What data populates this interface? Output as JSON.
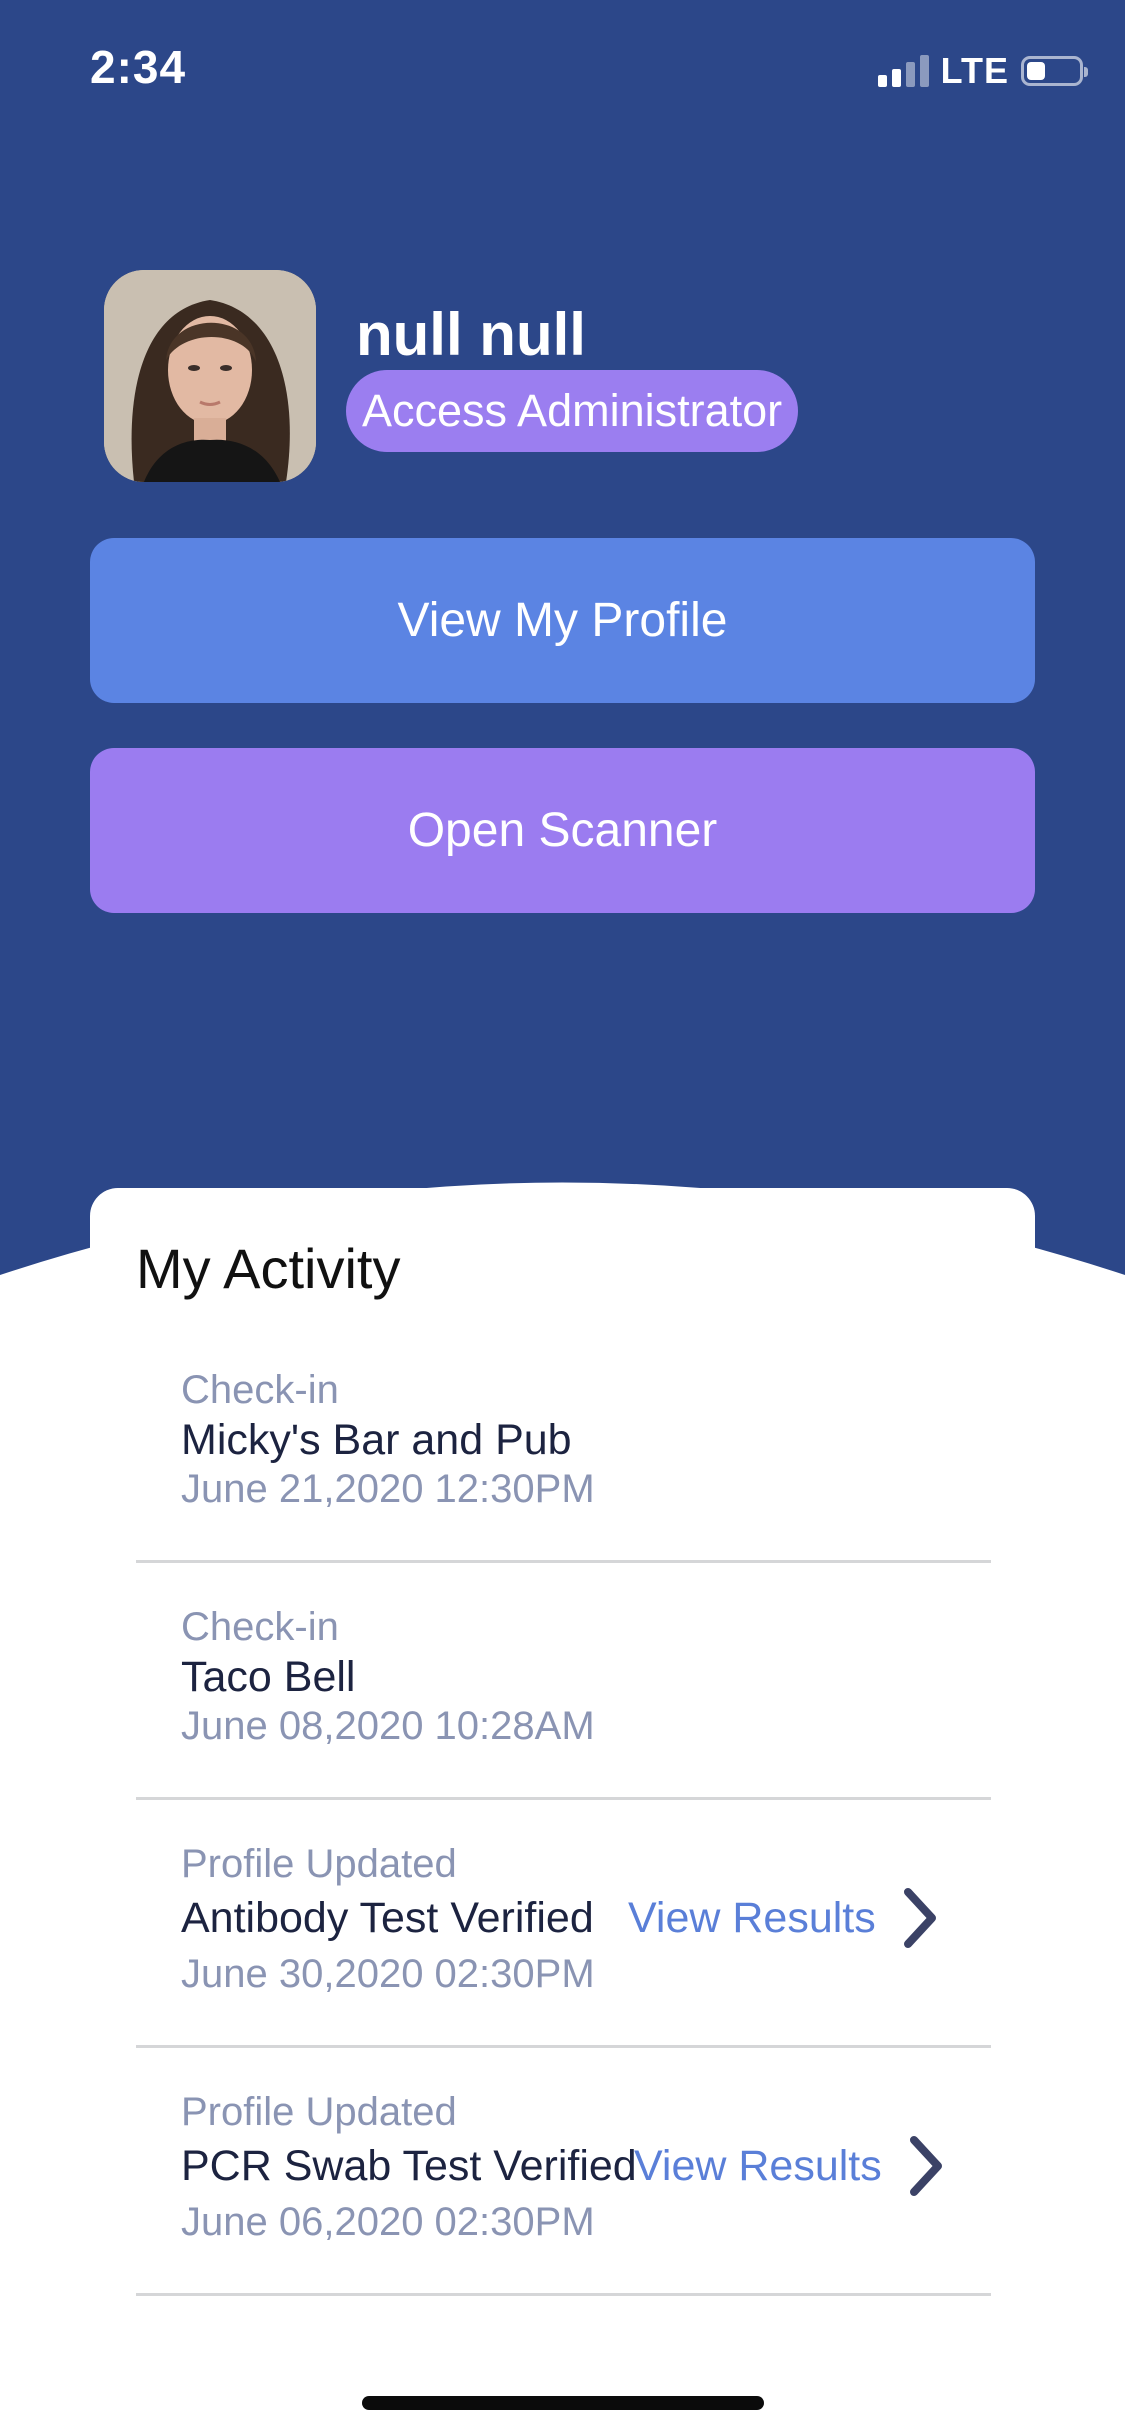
{
  "status_bar": {
    "time": "2:34",
    "network": "LTE",
    "signal_bars_active": 2,
    "signal_bars_total": 4,
    "battery_level": 0.35
  },
  "colors": {
    "header_bg": "#2c4789",
    "profile_button": "#5b84e3",
    "scanner_button": "#9b7cf0",
    "badge": "#9b7ef0",
    "link": "#5a7fd8",
    "muted_text": "#8a94b3"
  },
  "profile": {
    "name": "null null",
    "role": "Access Administrator",
    "avatar_icon": "user-photo"
  },
  "buttons": {
    "view_profile": "View My Profile",
    "open_scanner": "Open Scanner"
  },
  "activity": {
    "title": "My Activity",
    "items": [
      {
        "type": "Check-in",
        "title": "Micky's Bar and Pub",
        "date": "June 21,2020 12:30PM"
      },
      {
        "type": "Check-in",
        "title": "Taco Bell",
        "date": "June 08,2020 10:28AM"
      },
      {
        "type": "Profile Updated",
        "title": "Antibody Test Verified",
        "date": "June 30,2020 02:30PM",
        "link": "View Results"
      },
      {
        "type": "Profile Updated",
        "title": "PCR Swab Test Verified",
        "date": "June 06,2020 02:30PM",
        "link": "View Results"
      }
    ]
  }
}
